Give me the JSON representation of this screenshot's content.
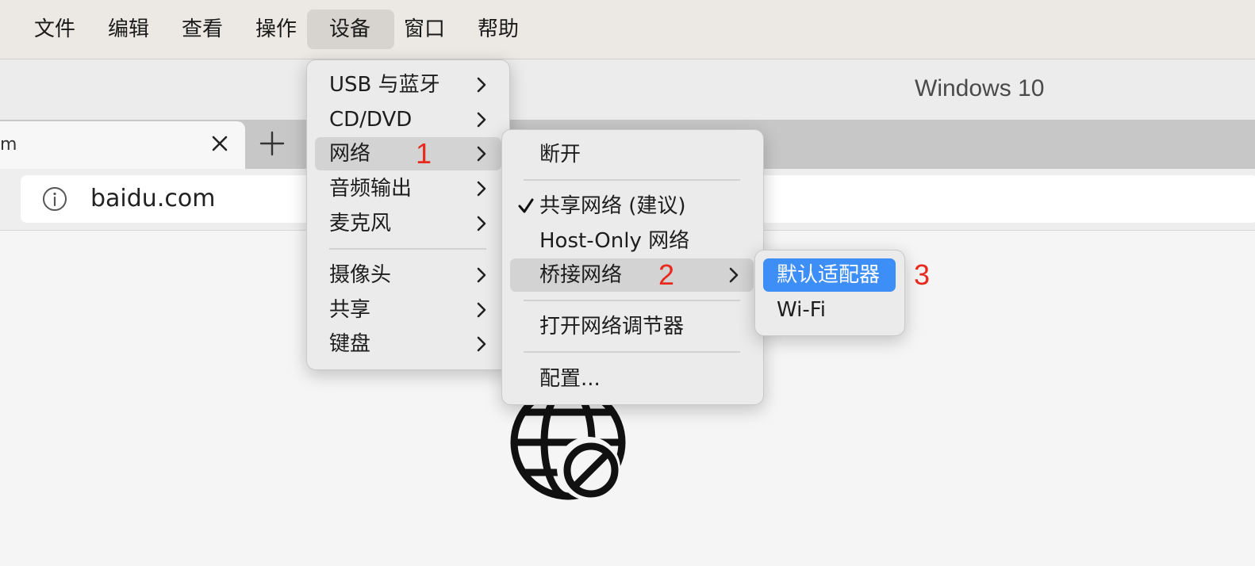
{
  "menubar": {
    "items": [
      "文件",
      "编辑",
      "查看",
      "操作",
      "设备",
      "窗口",
      "帮助"
    ]
  },
  "window": {
    "title": "Windows 10"
  },
  "tab": {
    "title": "m"
  },
  "address": {
    "url": "baidu.com"
  },
  "devices_menu": {
    "items": [
      "USB 与蓝牙",
      "CD/DVD",
      "网络",
      "音频输出",
      "麦克风",
      "摄像头",
      "共享",
      "键盘"
    ],
    "highlighted": "网络"
  },
  "network_menu": {
    "items": [
      "断开",
      "共享网络 (建议)",
      "Host-Only 网络",
      "桥接网络",
      "打开网络调节器",
      "配置..."
    ],
    "checked": "共享网络 (建议)",
    "highlighted": "桥接网络"
  },
  "bridge_menu": {
    "items": [
      "默认适配器",
      "Wi-Fi"
    ],
    "selected": "默认适配器"
  },
  "annotations": [
    "1",
    "2",
    "3"
  ],
  "colors": {
    "annotation": "#e8291c",
    "selection": "#3d8ef6"
  }
}
